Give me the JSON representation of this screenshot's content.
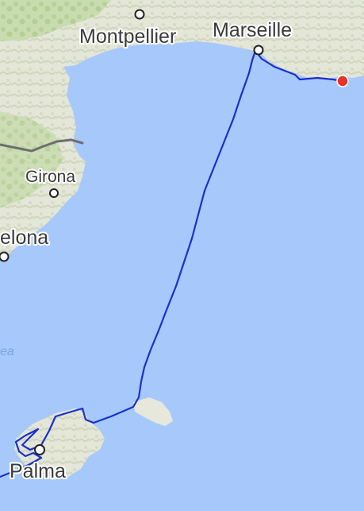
{
  "map": {
    "cities": [
      {
        "id": "montpellier",
        "name": "Montpellier"
      },
      {
        "id": "marseille",
        "name": "Marseille"
      },
      {
        "id": "girona",
        "name": "Girona"
      },
      {
        "id": "barcelona",
        "name": "elona"
      },
      {
        "id": "palma",
        "name": "Palma"
      }
    ],
    "sea_label_fragment": "ea",
    "colors": {
      "water": "#a6c8fb",
      "land": "#e9eadf",
      "relief": "#d4dbc2",
      "forest": "#bfd8a4",
      "route": "#1b2fd0",
      "current_position": "#e8322a",
      "border": "#6e6e6e"
    }
  }
}
